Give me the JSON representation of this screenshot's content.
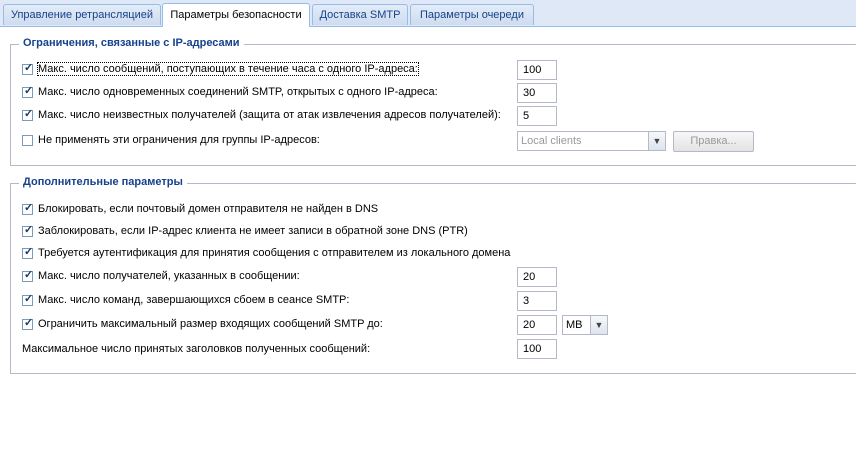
{
  "tabs": [
    {
      "label": "Управление ретрансляцией"
    },
    {
      "label": "Параметры безопасности"
    },
    {
      "label": "Доставка SMTP"
    },
    {
      "label": "Параметры очереди"
    }
  ],
  "ip_group": {
    "legend": "Ограничения, связанные с IP-адресами",
    "max_msgs_hour_label": "Макс. число сообщений, поступающих в течение часа с одного IP-адреса:",
    "max_msgs_hour_value": "100",
    "max_conn_label": "Макс. число одновременных соединений SMTP, открытых с одного IP-адреса:",
    "max_conn_value": "30",
    "max_unknown_label": "Макс. число неизвестных получателей (защита от атак извлечения адресов получателей):",
    "max_unknown_value": "5",
    "exclude_label": "Не применять эти ограничения для группы IP-адресов:",
    "exclude_group_value": "Local clients",
    "edit_button": "Правка..."
  },
  "adv_group": {
    "legend": "Дополнительные параметры",
    "block_dns_label": "Блокировать, если почтовый домен отправителя не найден в DNS",
    "block_ptr_label": "Заблокировать, если IP-адрес клиента не имеет записи в обратной зоне DNS (PTR)",
    "require_auth_label": "Требуется аутентификация для принятия сообщения с отправителем из локального домена",
    "max_recipients_label": "Макс. число получателей, указанных в сообщении:",
    "max_recipients_value": "20",
    "max_failed_label": "Макс. число команд, завершающихся сбоем в сеансе SMTP:",
    "max_failed_value": "3",
    "max_size_label": "Ограничить максимальный размер входящих сообщений SMTP до:",
    "max_size_value": "20",
    "max_size_unit": "MB",
    "max_headers_label": "Максимальное число принятых заголовков полученных сообщений:",
    "max_headers_value": "100"
  },
  "icons": {
    "checkmark": "✓",
    "dropdown": "▼"
  }
}
